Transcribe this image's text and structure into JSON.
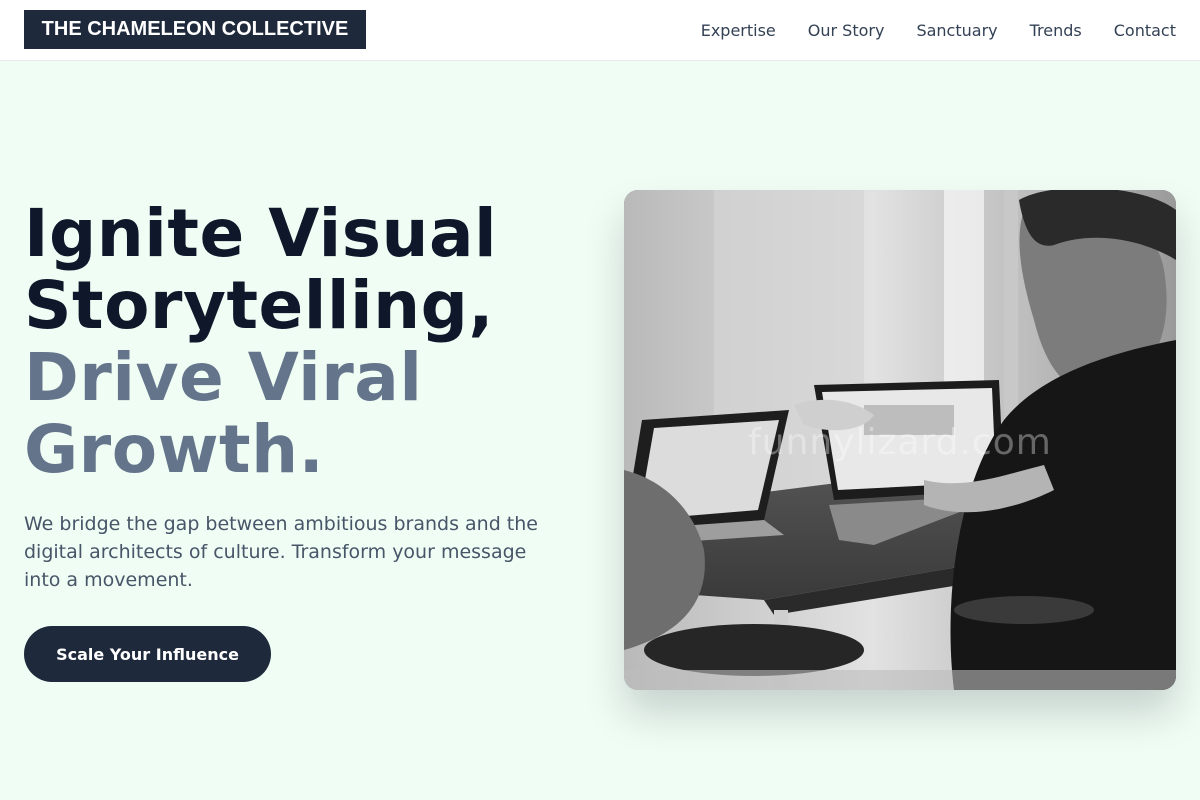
{
  "header": {
    "logo_text": "THE CHAMELEON COLLECTIVE",
    "nav": [
      "Expertise",
      "Our Story",
      "Sanctuary",
      "Trends",
      "Contact"
    ]
  },
  "hero": {
    "headline_line1": "Ignite Visual",
    "headline_line2": "Storytelling,",
    "headline_line3": "Drive Viral",
    "headline_line4": "Growth.",
    "subtitle": "We bridge the gap between ambitious brands and the digital architects of culture. Transform your message into a movement.",
    "cta_label": "Scale Your Influence",
    "image_watermark": "funnylizard.com"
  },
  "colors": {
    "background": "#f0fdf4",
    "dark": "#1e293b",
    "headline_dark": "#0f172a",
    "headline_muted": "#64748b"
  }
}
